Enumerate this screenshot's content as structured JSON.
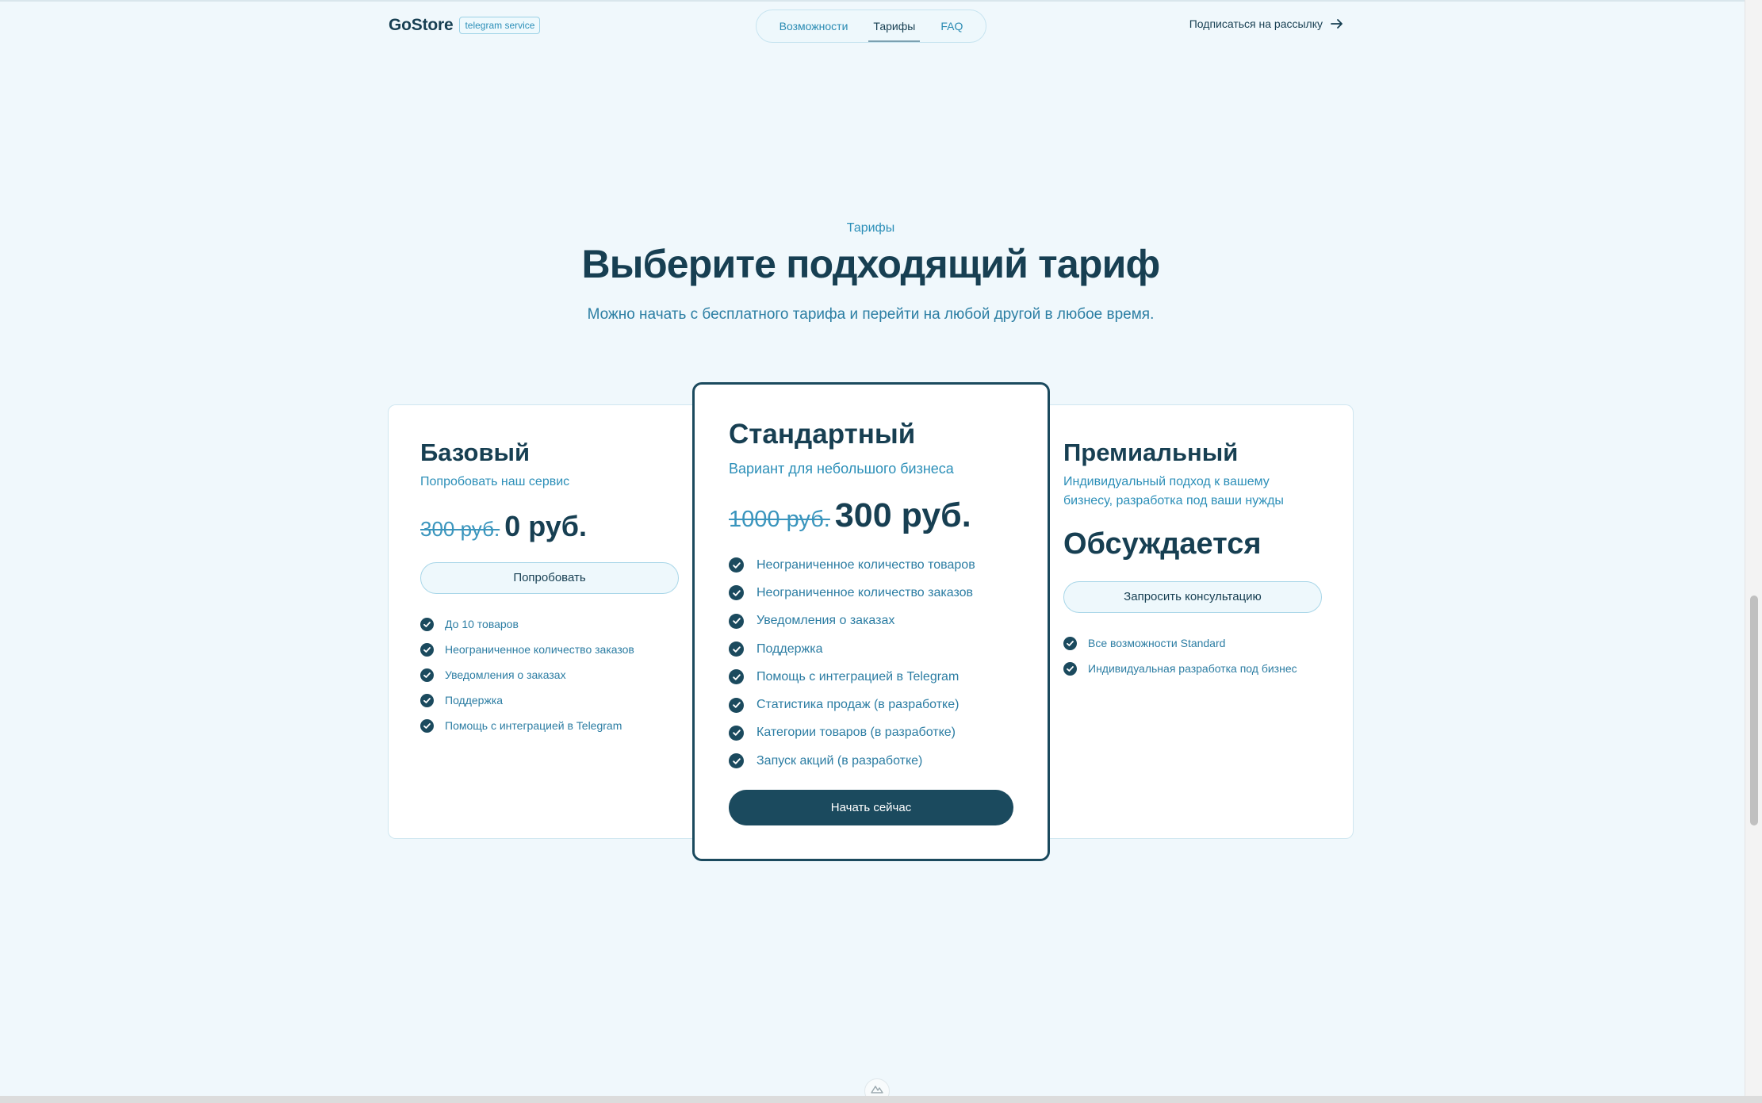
{
  "header": {
    "logo": "GoStore",
    "badge": "telegram service",
    "nav": [
      {
        "label": "Возможности"
      },
      {
        "label": "Тарифы"
      },
      {
        "label": "FAQ"
      }
    ],
    "subscribe_label": "Подписаться на рассылку"
  },
  "hero": {
    "eyebrow": "Тарифы",
    "title": "Выберите подходящий тариф",
    "subtitle": "Можно начать с бесплатного тарифа и перейти на любой другой в любое время."
  },
  "plans": {
    "basic": {
      "name": "Базовый",
      "desc": "Попробовать наш сервис",
      "old_price": "300 руб.",
      "price": "0 руб.",
      "button": "Попробовать",
      "features": [
        "До 10 товаров",
        "Неограниченное количество заказов",
        "Уведомления о заказах",
        "Поддержка",
        "Помощь с интеграцией в Telegram"
      ]
    },
    "standard": {
      "name": "Стандартный",
      "desc": "Вариант для небольшого бизнеса",
      "old_price": "1000 руб.",
      "price": "300 руб.",
      "button": "Начать сейчас",
      "features": [
        "Неограниченное количество товаров",
        "Неограниченное количество заказов",
        "Уведомления о заказах",
        "Поддержка",
        "Помощь с интеграцией в Telegram",
        "Статистика продаж (в разработке)",
        "Категории товаров (в разработке)",
        "Запуск акций (в разработке)"
      ]
    },
    "premium": {
      "name": "Премиальный",
      "desc": "Индивидуальный подход к вашему бизнесу, разработка под ваши нужды",
      "price": "Обсуждается",
      "button": "Запросить консультацию",
      "features": [
        "Все возможности Standard",
        "Индивидуальная разработка под бизнес"
      ]
    }
  },
  "colors": {
    "background": "#f0f8fc",
    "primary": "#1b4a5e",
    "accent": "#2c8fb8"
  }
}
